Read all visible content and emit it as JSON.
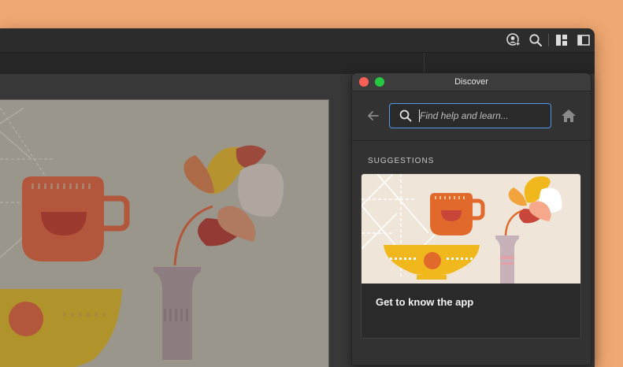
{
  "window": {
    "top_icons": [
      {
        "icon": "user-add-icon"
      },
      {
        "icon": "search-icon"
      },
      {
        "icon": "workspace-layout-icon"
      },
      {
        "icon": "panel-toggle-icon"
      }
    ]
  },
  "discover": {
    "title": "Discover",
    "search": {
      "placeholder": "Find help and learn...",
      "value": ""
    },
    "back_icon": "arrow-left-icon",
    "home_icon": "home-icon",
    "section_label": "SUGGESTIONS",
    "card": {
      "title": "Get to know the app"
    }
  },
  "colors": {
    "background": "#f0a872",
    "window": "#2f2f2f",
    "canvas": "#9b968c",
    "accent": "#4d9aea",
    "traffic_red": "#fe5f57",
    "traffic_green": "#28c840",
    "illustration_orange": "#e0692b",
    "illustration_yellow": "#f0b81c",
    "illustration_red": "#c8453a",
    "illustration_lilac": "#c8b2ba"
  }
}
